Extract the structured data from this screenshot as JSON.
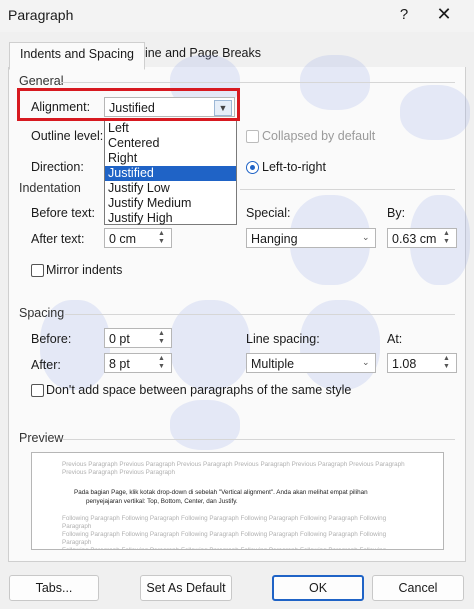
{
  "window": {
    "title": "Paragraph",
    "help": "?",
    "close": "✕"
  },
  "tabs": [
    {
      "label": "Indents and Spacing"
    },
    {
      "label": "Line and Page Breaks"
    }
  ],
  "general": {
    "heading": "General",
    "alignment_label": "Alignment:",
    "alignment_value": "Justified",
    "alignment_options": [
      "Left",
      "Centered",
      "Right",
      "Justified",
      "Justify Low",
      "Justify Medium",
      "Justify High"
    ],
    "outline_label": "Outline level:",
    "collapsed_label": "Collapsed by default",
    "direction_label": "Direction:",
    "ltr_label": "Left-to-right"
  },
  "indentation": {
    "heading": "Indentation",
    "before_label": "Before text:",
    "after_label": "After text:",
    "after_value": "0 cm",
    "special_label": "Special:",
    "special_value": "Hanging",
    "by_label": "By:",
    "by_value": "0.63 cm",
    "mirror_label": "Mirror indents"
  },
  "spacing": {
    "heading": "Spacing",
    "before_label": "Before:",
    "before_value": "0 pt",
    "after_label": "After:",
    "after_value": "8 pt",
    "line_spacing_label": "Line spacing:",
    "line_spacing_value": "Multiple",
    "at_label": "At:",
    "at_value": "1.08",
    "dont_add_label": "Don't add space between paragraphs of the same style"
  },
  "preview": {
    "heading": "Preview",
    "prev_line1": "Previous Paragraph Previous Paragraph Previous Paragraph Previous Paragraph Previous Paragraph Previous Paragraph",
    "prev_line2": "Previous Paragraph Previous Paragraph",
    "text_line1": "Pada bagian Page, klik kotak drop-down di sebelah \"Vertical alignment\". Anda akan melihat empat pilihan",
    "text_line2": "penyejajaran vertikal: Top, Bottom, Center, dan Justify.",
    "next_line": "Following Paragraph Following Paragraph Following Paragraph Following Paragraph Following Paragraph Following Paragraph"
  },
  "buttons": {
    "tabs": "Tabs...",
    "set_default": "Set As Default",
    "ok": "OK",
    "cancel": "Cancel"
  },
  "colors": {
    "accent": "#1f63c6",
    "highlight": "#d71920"
  }
}
